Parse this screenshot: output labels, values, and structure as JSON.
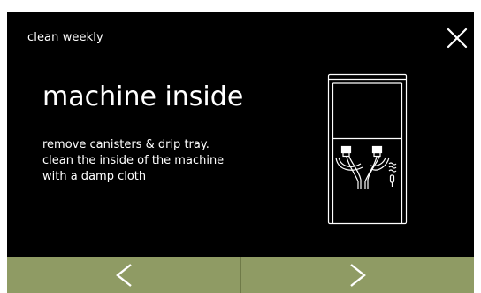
{
  "header": {
    "title": "clean weekly",
    "close_icon": "close-icon"
  },
  "main": {
    "heading": "machine inside",
    "instructions": [
      "remove canisters & drip tray.",
      "clean the inside of the machine",
      "with a damp cloth"
    ],
    "illustration": "machine-inside-illustration"
  },
  "navigation": {
    "previous_icon": "chevron-left-icon",
    "next_icon": "chevron-right-icon"
  },
  "colors": {
    "screen_background": "#000000",
    "text": "#ffffff",
    "nav_bar": "#8f9b64",
    "nav_divider": "#6f7a48"
  }
}
